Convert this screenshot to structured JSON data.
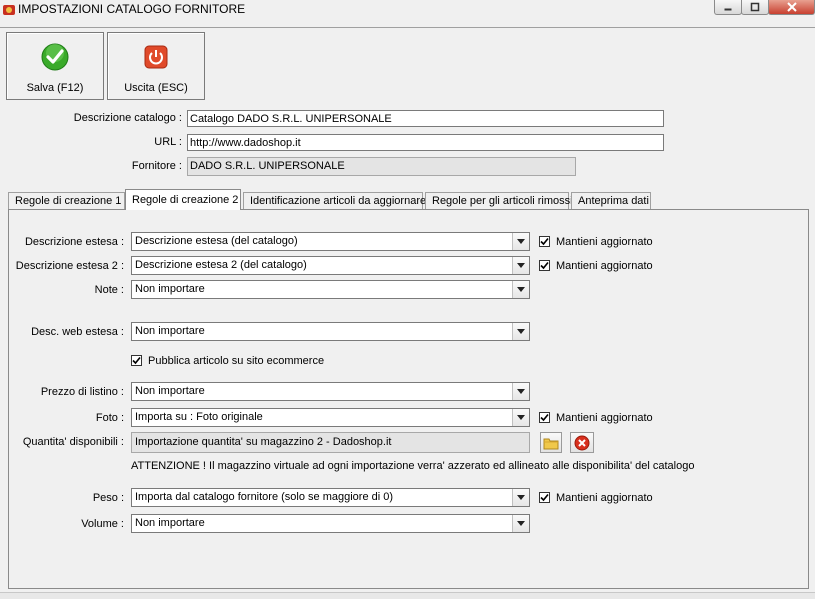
{
  "window": {
    "title": "IMPOSTAZIONI CATALOGO FORNITORE"
  },
  "toolbar": {
    "save_label": "Salva (F12)",
    "exit_label": "Uscita (ESC)"
  },
  "header": {
    "descr_label": "Descrizione catalogo :",
    "descr_value": "Catalogo DADO S.R.L. UNIPERSONALE",
    "url_label": "URL :",
    "url_value": "http://www.dadoshop.it",
    "supplier_label": "Fornitore :",
    "supplier_value": "DADO S.R.L. UNIPERSONALE"
  },
  "tabs": [
    {
      "label": "Regole di creazione 1"
    },
    {
      "label": "Regole di creazione 2"
    },
    {
      "label": "Identificazione articoli da aggiornare"
    },
    {
      "label": "Regole per gli articoli rimossi"
    },
    {
      "label": "Anteprima dati"
    }
  ],
  "rules": {
    "keep_label": "Mantieni aggiornato",
    "desc_ext": {
      "label": "Descrizione estesa :",
      "value": "Descrizione estesa (del catalogo)"
    },
    "desc_ext2": {
      "label": "Descrizione estesa 2 :",
      "value": "Descrizione estesa 2 (del catalogo)"
    },
    "note": {
      "label": "Note :",
      "value": "Non importare"
    },
    "web_desc": {
      "label": "Desc. web estesa :",
      "value": "Non importare"
    },
    "publish_label": "Pubblica articolo su sito ecommerce",
    "price": {
      "label": "Prezzo di listino :",
      "value": "Non importare"
    },
    "photo": {
      "label": "Foto :",
      "value": "Importa su : Foto originale"
    },
    "qty": {
      "label": "Quantita' disponibili :",
      "value": "Importazione quantita' su magazzino 2 - Dadoshop.it"
    },
    "warning": "ATTENZIONE ! Il magazzino virtuale ad ogni importazione verra' azzerato ed allineato alle disponibilita' del catalogo",
    "weight": {
      "label": "Peso :",
      "value": "Importa dal catalogo fornitore (solo se maggiore di 0)"
    },
    "volume": {
      "label": "Volume :",
      "value": "Non importare"
    }
  }
}
